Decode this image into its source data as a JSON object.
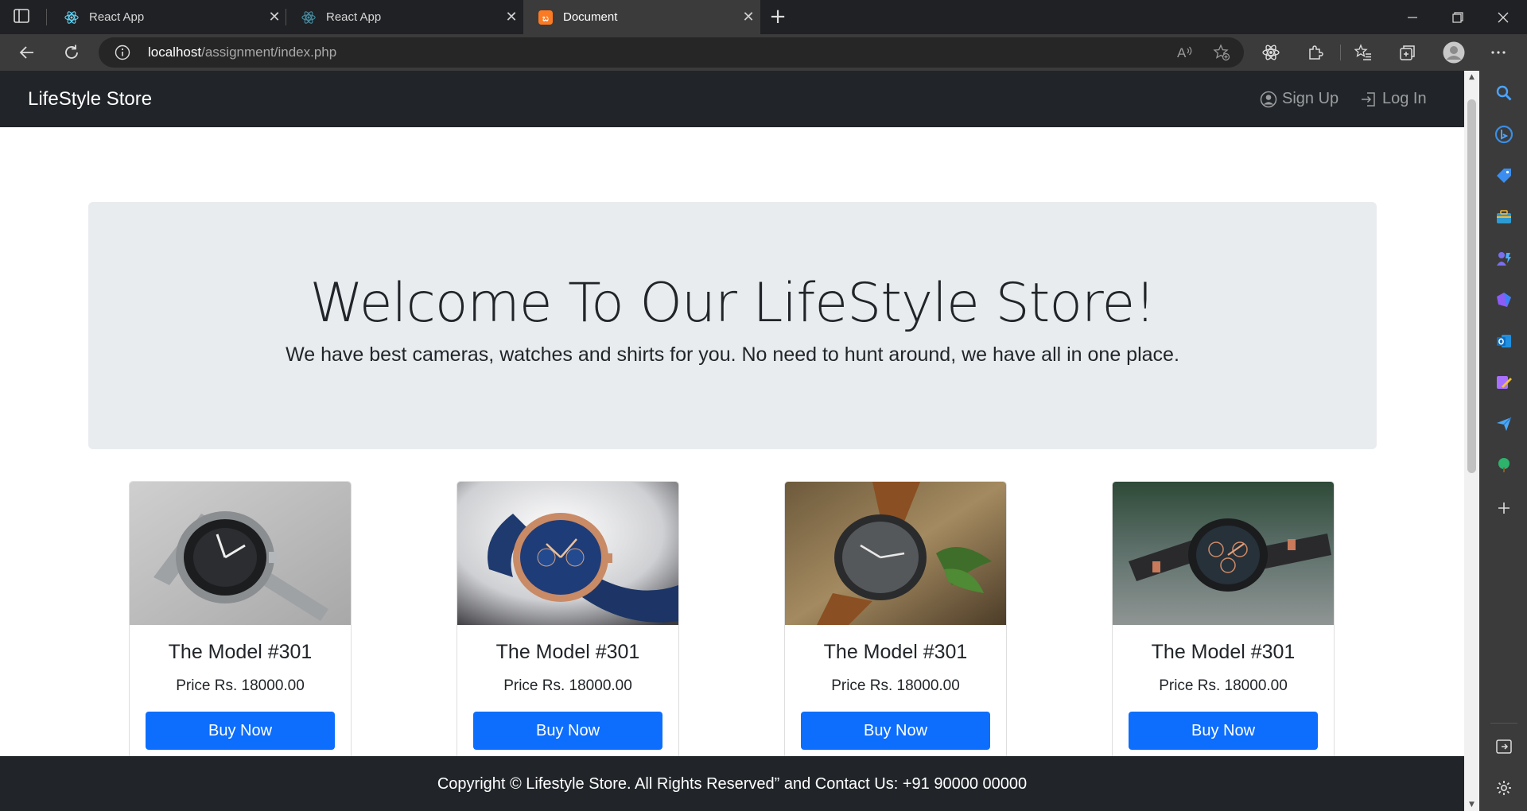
{
  "browser": {
    "tabs": [
      {
        "title": "React App",
        "favicon": "react-icon",
        "active": false
      },
      {
        "title": "React App",
        "favicon": "react-icon",
        "active": false
      },
      {
        "title": "Document",
        "favicon": "xampp-icon",
        "active": true
      }
    ],
    "url_host": "localhost",
    "url_path": "/assignment/index.php"
  },
  "navbar": {
    "brand": "LifeStyle Store",
    "signup_label": "Sign Up",
    "login_label": "Log In"
  },
  "jumbotron": {
    "title": "Welcome To Our LifeStyle Store!",
    "lead": "We have best cameras, watches and shirts for you. No need to hunt around, we have all in one place."
  },
  "products": [
    {
      "title": "The Model #301",
      "price": "Price Rs. 18000.00",
      "button": "Buy Now",
      "image": "silver-steel-watch"
    },
    {
      "title": "The Model #301",
      "price": "Price Rs. 18000.00",
      "button": "Buy Now",
      "image": "blue-leather-rose-gold-watch"
    },
    {
      "title": "The Model #301",
      "price": "Price Rs. 18000.00",
      "button": "Buy Now",
      "image": "black-dial-brown-strap-watch"
    },
    {
      "title": "The Model #301",
      "price": "Price Rs. 18000.00",
      "button": "Buy Now",
      "image": "chronograph-rose-gold-watch"
    }
  ],
  "footer": {
    "text": "Copyright © Lifestyle Store. All Rights Reserved” and Contact Us: +91 90000 00000"
  },
  "colors": {
    "navbar": "#212529",
    "jumbotron": "#e9ecef",
    "primary_button": "#0d6efd"
  }
}
